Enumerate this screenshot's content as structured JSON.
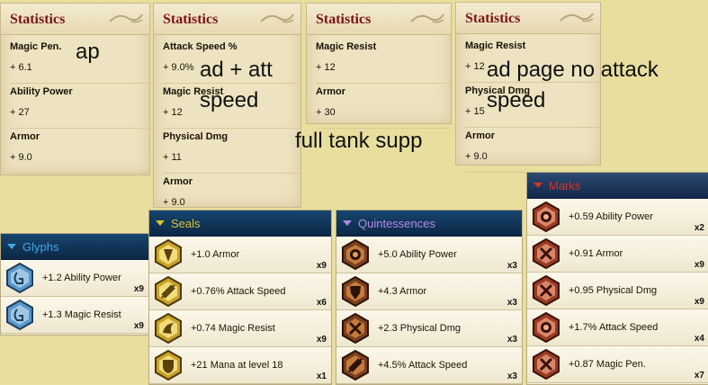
{
  "stat_panels": [
    {
      "title": "Statistics",
      "rows": [
        {
          "label": "Magic Pen.",
          "value": "+ 6.1"
        },
        {
          "label": "Ability Power",
          "value": "+ 27"
        },
        {
          "label": "Armor",
          "value": "+ 9.0"
        }
      ]
    },
    {
      "title": "Statistics",
      "rows": [
        {
          "label": "Attack Speed %",
          "value": "+ 9.0%"
        },
        {
          "label": "Magic Resist",
          "value": "+ 12"
        },
        {
          "label": "Physical Dmg",
          "value": "+ 11"
        },
        {
          "label": "Armor",
          "value": "+ 9.0"
        }
      ]
    },
    {
      "title": "Statistics",
      "rows": [
        {
          "label": "Magic Resist",
          "value": "+ 12"
        },
        {
          "label": "Armor",
          "value": "+ 30"
        }
      ]
    },
    {
      "title": "Statistics",
      "rows": [
        {
          "label": "Magic Resist",
          "value": "+ 12"
        },
        {
          "label": "Physical Dmg",
          "value": "+ 15"
        },
        {
          "label": "Armor",
          "value": "+ 9.0"
        }
      ]
    }
  ],
  "annotations": {
    "ap": "ap",
    "ad_att_line1": "ad + att",
    "ad_att_line2": "speed",
    "tank": "full tank supp",
    "ad_page_line1": "ad page no attack",
    "ad_page_line2": "speed"
  },
  "rune_panels": [
    {
      "title": "Glyphs",
      "title_color": "#3fa6e8",
      "rows": [
        {
          "text": "+1.2 Ability Power",
          "count": "x9"
        },
        {
          "text": "+1.3 Magic Resist",
          "count": "x9"
        }
      ]
    },
    {
      "title": "Seals",
      "title_color": "#d8c530",
      "rows": [
        {
          "text": "+1.0 Armor",
          "count": "x9"
        },
        {
          "text": "+0.76% Attack Speed",
          "count": "x6"
        },
        {
          "text": "+0.74 Magic Resist",
          "count": "x9"
        },
        {
          "text": "+21 Mana at level 18",
          "count": "x1"
        }
      ]
    },
    {
      "title": "Quintessences",
      "title_color": "#b48ae6",
      "rows": [
        {
          "text": "+5.0 Ability Power",
          "count": "x3"
        },
        {
          "text": "+4.3 Armor",
          "count": "x3"
        },
        {
          "text": "+2.3 Physical Dmg",
          "count": "x3"
        },
        {
          "text": "+4.5% Attack Speed",
          "count": "x3"
        }
      ]
    },
    {
      "title": "Marks",
      "title_color": "#d4342a",
      "rows": [
        {
          "text": "+0.59 Ability Power",
          "count": "x2"
        },
        {
          "text": "+0.91 Armor",
          "count": "x9"
        },
        {
          "text": "+0.95 Physical Dmg",
          "count": "x9"
        },
        {
          "text": "+1.7% Attack Speed",
          "count": "x4"
        },
        {
          "text": "+0.87 Magic Pen.",
          "count": "x7"
        }
      ]
    }
  ],
  "colors": {
    "stat_title": "#7a1515",
    "glyph_icon": "#5b97c9",
    "seal_icon": "#c9a227",
    "quint_icon": "#7a3f1e",
    "mark_icon": "#9a3b24"
  },
  "icons": {
    "glyphs": [
      "glyph-rune-icon",
      "glyph-rune-icon"
    ],
    "seals": [
      "seal-armor-icon",
      "seal-attack-speed-icon",
      "seal-magic-resist-icon",
      "seal-mana-icon"
    ],
    "quintessences": [
      "quint-ability-power-icon",
      "quint-armor-icon",
      "quint-physical-dmg-icon",
      "quint-attack-speed-icon"
    ],
    "marks": [
      "mark-ability-power-icon",
      "mark-armor-icon",
      "mark-physical-dmg-icon",
      "mark-attack-speed-icon",
      "mark-magic-pen-icon"
    ]
  }
}
